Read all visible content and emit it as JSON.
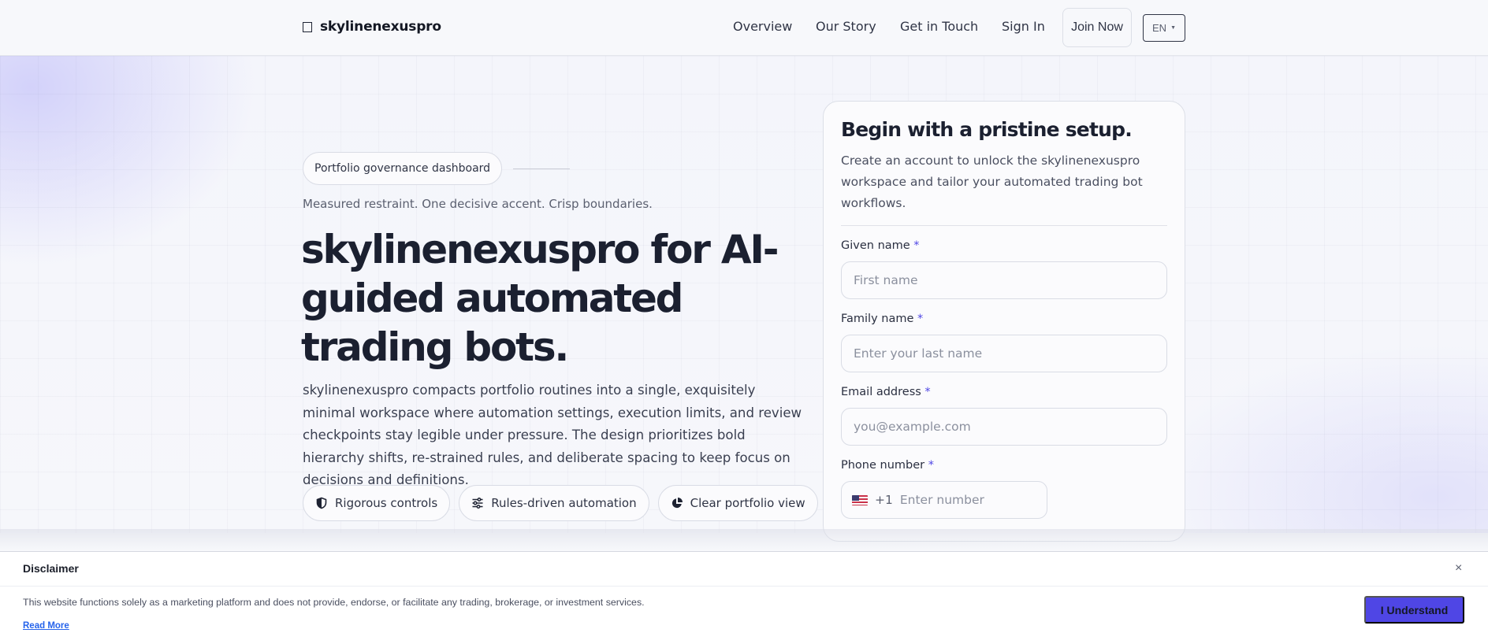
{
  "header": {
    "brand": "skylinenexuspro",
    "nav": {
      "overview": "Overview",
      "story": "Our Story",
      "touch": "Get in Touch",
      "signin": "Sign In",
      "join": "Join Now"
    },
    "language": "EN"
  },
  "hero": {
    "chip": "Portfolio governance dashboard",
    "tagline": "Measured restraint. One decisive accent. Crisp boundaries.",
    "title": "skylinenexuspro for AI-guided automated trading bots.",
    "description": "skylinenexuspro compacts portfolio routines into a single, exquisitely minimal workspace where automation settings, execution limits, and review checkpoints stay legible under pressure. The design prioritizes bold hierarchy shifts, re-strained rules, and deliberate spacing to keep focus on decisions and definitions.",
    "features": [
      {
        "label": "Rigorous controls",
        "icon": "shield-icon"
      },
      {
        "label": "Rules-driven automation",
        "icon": "sliders-icon"
      },
      {
        "label": "Clear portfolio view",
        "icon": "pie-chart-icon"
      }
    ]
  },
  "signup": {
    "title": "Begin with a pristine setup.",
    "description": "Create an account to unlock the skylinenexuspro workspace and tailor your automated trading bot workflows.",
    "required_mark": "*",
    "fields": {
      "given": {
        "label": "Given name",
        "placeholder": "First name"
      },
      "family": {
        "label": "Family name",
        "placeholder": "Enter your last name"
      },
      "email": {
        "label": "Email address",
        "placeholder": "you@example.com"
      },
      "phone": {
        "label": "Phone number",
        "dial_code": "+1",
        "placeholder": "Enter number",
        "flag": "us-flag-icon"
      }
    }
  },
  "disclaimer": {
    "title": "Disclaimer",
    "close": "×",
    "text": "This website functions solely as a marketing platform and does not provide, endorse, or facilitate any trading, brokerage, or investment services.",
    "link": "Read More",
    "button": "I Understand"
  },
  "colors": {
    "accent": "#4f46e5",
    "link": "#2563eb",
    "text": "#1b2030"
  }
}
